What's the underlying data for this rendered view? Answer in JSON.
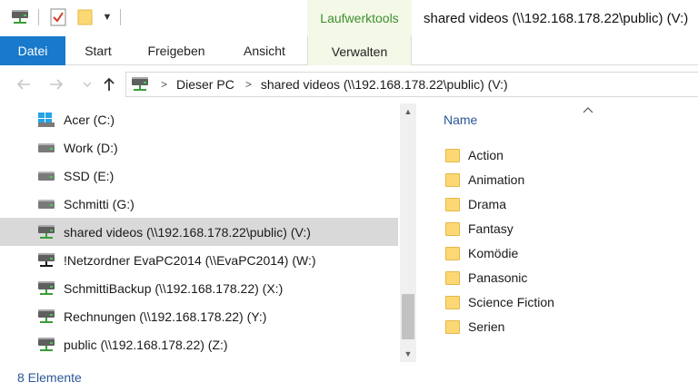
{
  "window": {
    "title": "shared videos (\\\\192.168.178.22\\public) (V:)",
    "contextual_tab_group": "Laufwerktools"
  },
  "ribbon": {
    "tabs": [
      {
        "label": "Datei"
      },
      {
        "label": "Start"
      },
      {
        "label": "Freigeben"
      },
      {
        "label": "Ansicht"
      },
      {
        "label": "Verwalten"
      }
    ]
  },
  "address": {
    "crumbs": [
      "Dieser PC",
      "shared videos (\\\\192.168.178.22\\public) (V:)"
    ]
  },
  "navpane": {
    "items": [
      {
        "label": "Acer (C:)",
        "icon": "windows-drive-icon"
      },
      {
        "label": "Work (D:)",
        "icon": "drive-icon"
      },
      {
        "label": "SSD (E:)",
        "icon": "drive-icon"
      },
      {
        "label": "Schmitti (G:)",
        "icon": "drive-icon"
      },
      {
        "label": "shared videos (\\\\192.168.178.22\\public) (V:)",
        "icon": "network-drive-icon",
        "selected": true
      },
      {
        "label": "!Netzordner EvaPC2014 (\\\\EvaPC2014) (W:)",
        "icon": "network-drive-disconnected-icon"
      },
      {
        "label": "SchmittiBackup (\\\\192.168.178.22) (X:)",
        "icon": "network-drive-icon"
      },
      {
        "label": "Rechnungen (\\\\192.168.178.22) (Y:)",
        "icon": "network-drive-icon"
      },
      {
        "label": "public (\\\\192.168.178.22) (Z:)",
        "icon": "network-drive-icon"
      }
    ]
  },
  "filepane": {
    "column_header": "Name",
    "items": [
      {
        "label": "Action"
      },
      {
        "label": "Animation"
      },
      {
        "label": "Drama"
      },
      {
        "label": "Fantasy"
      },
      {
        "label": "Komödie"
      },
      {
        "label": "Panasonic"
      },
      {
        "label": "Science Fiction"
      },
      {
        "label": "Serien"
      }
    ]
  },
  "status": {
    "count": "8 Elemente"
  },
  "colors": {
    "file_tab": "#1979ca",
    "contextual_tab_bg": "#f3f8e7",
    "contextual_tab_text": "#3f8f2f",
    "selection": "#d9d9d9",
    "folder": "#fcd874"
  }
}
